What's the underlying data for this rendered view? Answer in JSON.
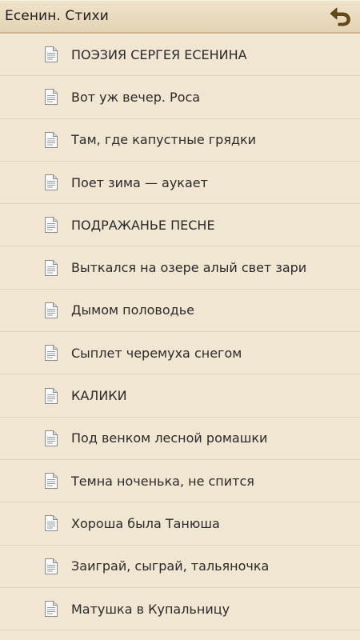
{
  "header": {
    "title": "Есенин. Стихи",
    "back_icon": "back-arrow-icon"
  },
  "colors": {
    "background": "#F1E6D2",
    "header_bg": "#E4D3B5",
    "back_icon": "#6A4A14",
    "divider": "#E2D4BD"
  },
  "items": [
    {
      "label": "ПОЭЗИЯ СЕРГЕЯ ЕСЕНИНА",
      "icon": "document-icon"
    },
    {
      "label": "Вот уж вечер. Роса",
      "icon": "document-icon"
    },
    {
      "label": "Там, где капустные грядки",
      "icon": "document-icon"
    },
    {
      "label": "Поет зима — аукает",
      "icon": "document-icon"
    },
    {
      "label": "ПОДРАЖАНЬЕ ПЕСНЕ",
      "icon": "document-icon"
    },
    {
      "label": "Выткался на озере алый свет зари",
      "icon": "document-icon"
    },
    {
      "label": "Дымом половодье",
      "icon": "document-icon"
    },
    {
      "label": "Сыплет черемуха снегом",
      "icon": "document-icon"
    },
    {
      "label": "КАЛИКИ",
      "icon": "document-icon"
    },
    {
      "label": "Под венком лесной ромашки",
      "icon": "document-icon"
    },
    {
      "label": "Темна ноченька, не спится",
      "icon": "document-icon"
    },
    {
      "label": "Хороша была Танюша",
      "icon": "document-icon"
    },
    {
      "label": "Заиграй, сыграй, тальяночка",
      "icon": "document-icon"
    },
    {
      "label": "Матушка в Купальницу",
      "icon": "document-icon"
    }
  ]
}
